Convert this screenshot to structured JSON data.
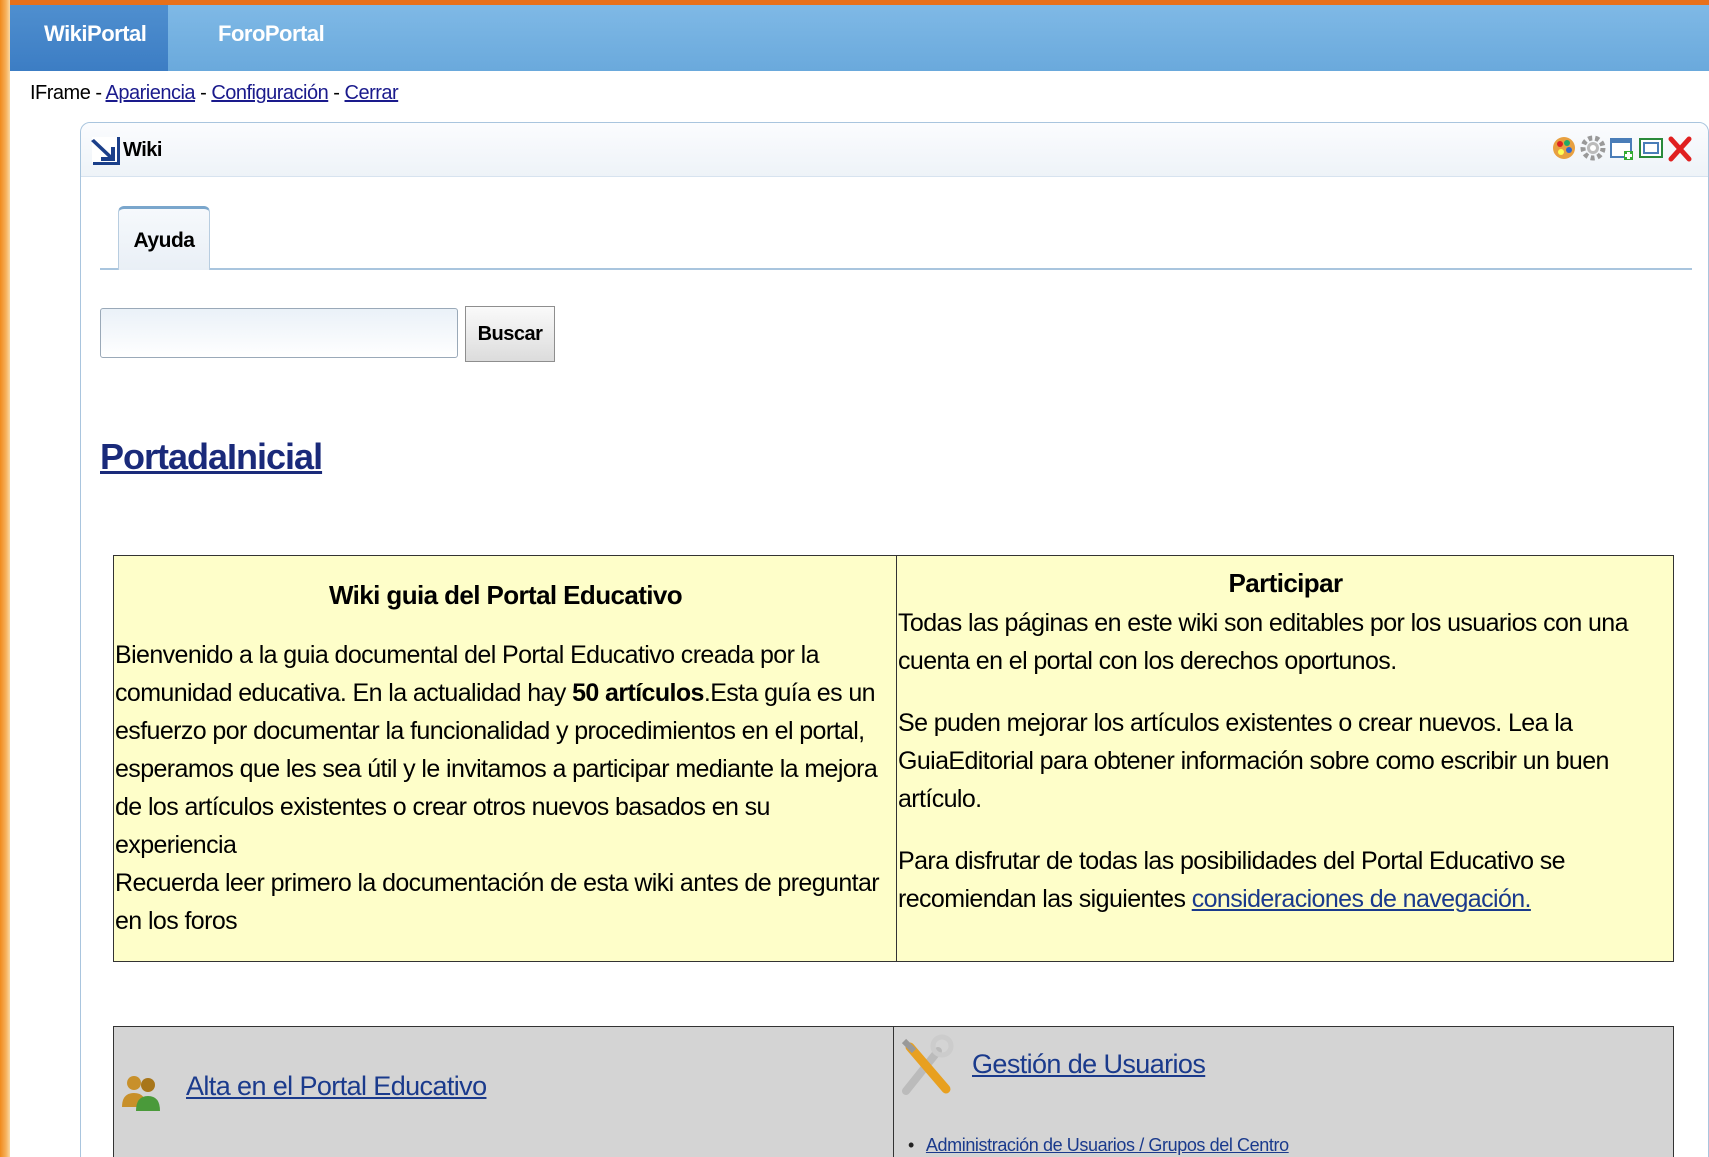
{
  "topbar": {
    "tabs": [
      {
        "label": "WikiPortal",
        "active": true
      },
      {
        "label": "ForoPortal",
        "active": false
      }
    ]
  },
  "iframe_bar": {
    "prefix": "IFrame - ",
    "link1": "Apariencia",
    "sep1": " - ",
    "link2": "Configuración",
    "sep2": " - ",
    "link3": "Cerrar"
  },
  "panel": {
    "title": "Wiki",
    "controls": [
      "palette-icon",
      "gear-icon",
      "window-add-icon",
      "maximize-icon",
      "close-icon"
    ]
  },
  "tabs": {
    "help_label": "Ayuda"
  },
  "search": {
    "value": "",
    "button_label": "Buscar"
  },
  "page": {
    "title": "PortadaInicial"
  },
  "intro": {
    "left_heading": "Wiki guia del Portal Educativo",
    "left_text_1": "Bienvenido a la guia documental del Portal Educativo creada por la comunidad educativa. En la actualidad hay ",
    "left_bold": "50 artículos",
    "left_text_2": ".Esta guía es un esfuerzo por documentar la funcionalidad y procedimientos en el portal, esperamos que les sea útil y le invitamos a participar mediante la mejora de los artículos existentes o crear otros nuevos basados en su experiencia",
    "left_text_3": "Recuerda leer primero la documentación de esta wiki antes de preguntar en los foros",
    "right_heading": "Participar",
    "right_p1": "Todas las páginas en este wiki son editables por los usuarios con una cuenta en el portal con los derechos oportunos.",
    "right_p2": "Se puden mejorar los artículos existentes o crear nuevos. Lea la GuiaEditorial para obtener información sobre como escribir un buen artículo.",
    "right_p3_text": " Para disfrutar de todas las posibilidades del Portal Educativo se recomiendan las siguientes ",
    "right_p3_link": "consideraciones de navegación."
  },
  "sections": {
    "left_link": "Alta en el Portal Educativo",
    "left_icon": "users-icon",
    "right_link": "Gestión de Usuarios",
    "right_icon": "tools-icon",
    "right_items": [
      "Administración de Usuarios / Grupos del Centro"
    ]
  },
  "colors": {
    "topbar": "#6aa9dc",
    "active_tab": "#3c7dc4",
    "intro_bg": "#fefec9",
    "section_bg": "#d4d4d4",
    "link": "#1a3a8c"
  }
}
